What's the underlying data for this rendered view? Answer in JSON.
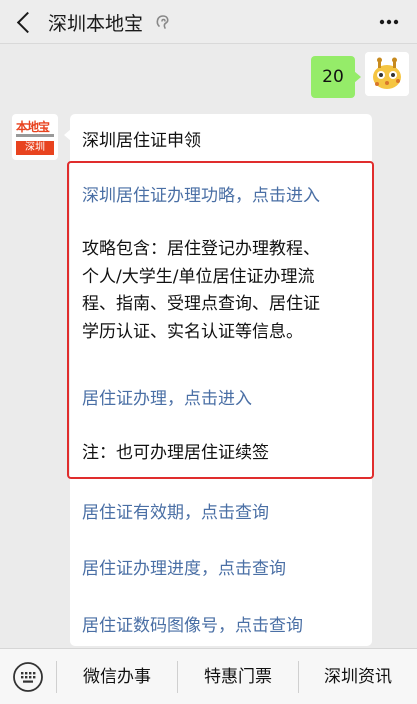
{
  "header": {
    "title": "深圳本地宝"
  },
  "chat": {
    "my_message": "20",
    "bot_logo": {
      "top": "本地宝",
      "bottom": "深圳"
    },
    "bot_message": {
      "title": "深圳居住证申领",
      "link_strategy": "深圳居住证办理功略，点击进入",
      "paragraph_lines": [
        "攻略包含：居住登记办理教程、",
        "个人/大学生/单位居住证办理流",
        "程、指南、受理点查询、居住证",
        "学历认证、实名认证等信息。"
      ],
      "link_apply": "居住证办理，点击进入",
      "note": "注：也可办理居住证续签",
      "link_validity": "居住证有效期，点击查询",
      "link_progress": "居住证办理进度，点击查询",
      "link_image_no": "居住证数码图像号，点击查询"
    }
  },
  "bottom_menu": {
    "items": [
      "微信办事",
      "特惠门票",
      "深圳资讯"
    ]
  },
  "colors": {
    "link": "#4a6fa5",
    "highlight_border": "#e02d2d",
    "my_bubble": "#95ec69",
    "brand": "#e8431f"
  }
}
